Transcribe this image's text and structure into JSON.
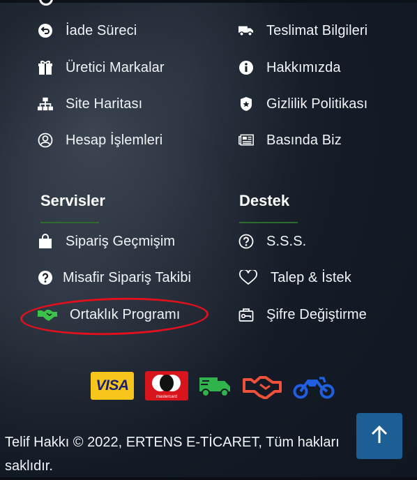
{
  "links": {
    "iade": "İade Süreci",
    "teslimat": "Teslimat Bilgileri",
    "uretici": "Üretici Markalar",
    "hakkimizda": "Hakkımızda",
    "site_haritasi": "Site Haritası",
    "gizlilik": "Gizlilik Politikası",
    "hesap": "Hesap İşlemleri",
    "basinda": "Basında Biz"
  },
  "servisler": {
    "heading": "Servisler",
    "siparis_gecmisim": "Sipariş Geçmişim",
    "misafir": "Misafir Sipariş Takibi",
    "ortaklik": "Ortaklık Programı"
  },
  "destek": {
    "heading": "Destek",
    "sss": "S.S.S.",
    "talep": "Talep & İstek",
    "sifre": "Şifre Değiştirme"
  },
  "payments": {
    "visa": "VISA",
    "mastercard": "mastercard"
  },
  "footer": {
    "copyright": "Telif Hakkı © 2022, ERTENS E-TİCARET, Tüm hakları saklıdır."
  },
  "icons": [
    "undo-circle-icon",
    "truck-icon",
    "gift-icon",
    "info-circle-icon",
    "sitemap-icon",
    "shield-badge-icon",
    "user-circle-icon",
    "newspaper-icon",
    "shopping-bag-icon",
    "question-circle-icon",
    "heart-icon",
    "handshake-icon",
    "key-box-icon",
    "arrow-up-icon"
  ],
  "colors": {
    "highlight_ring": "#e0101c",
    "handshake_green": "#3cc24a",
    "heading_underline": "#2e6b2f",
    "to_top_button": "#1d5f95"
  }
}
